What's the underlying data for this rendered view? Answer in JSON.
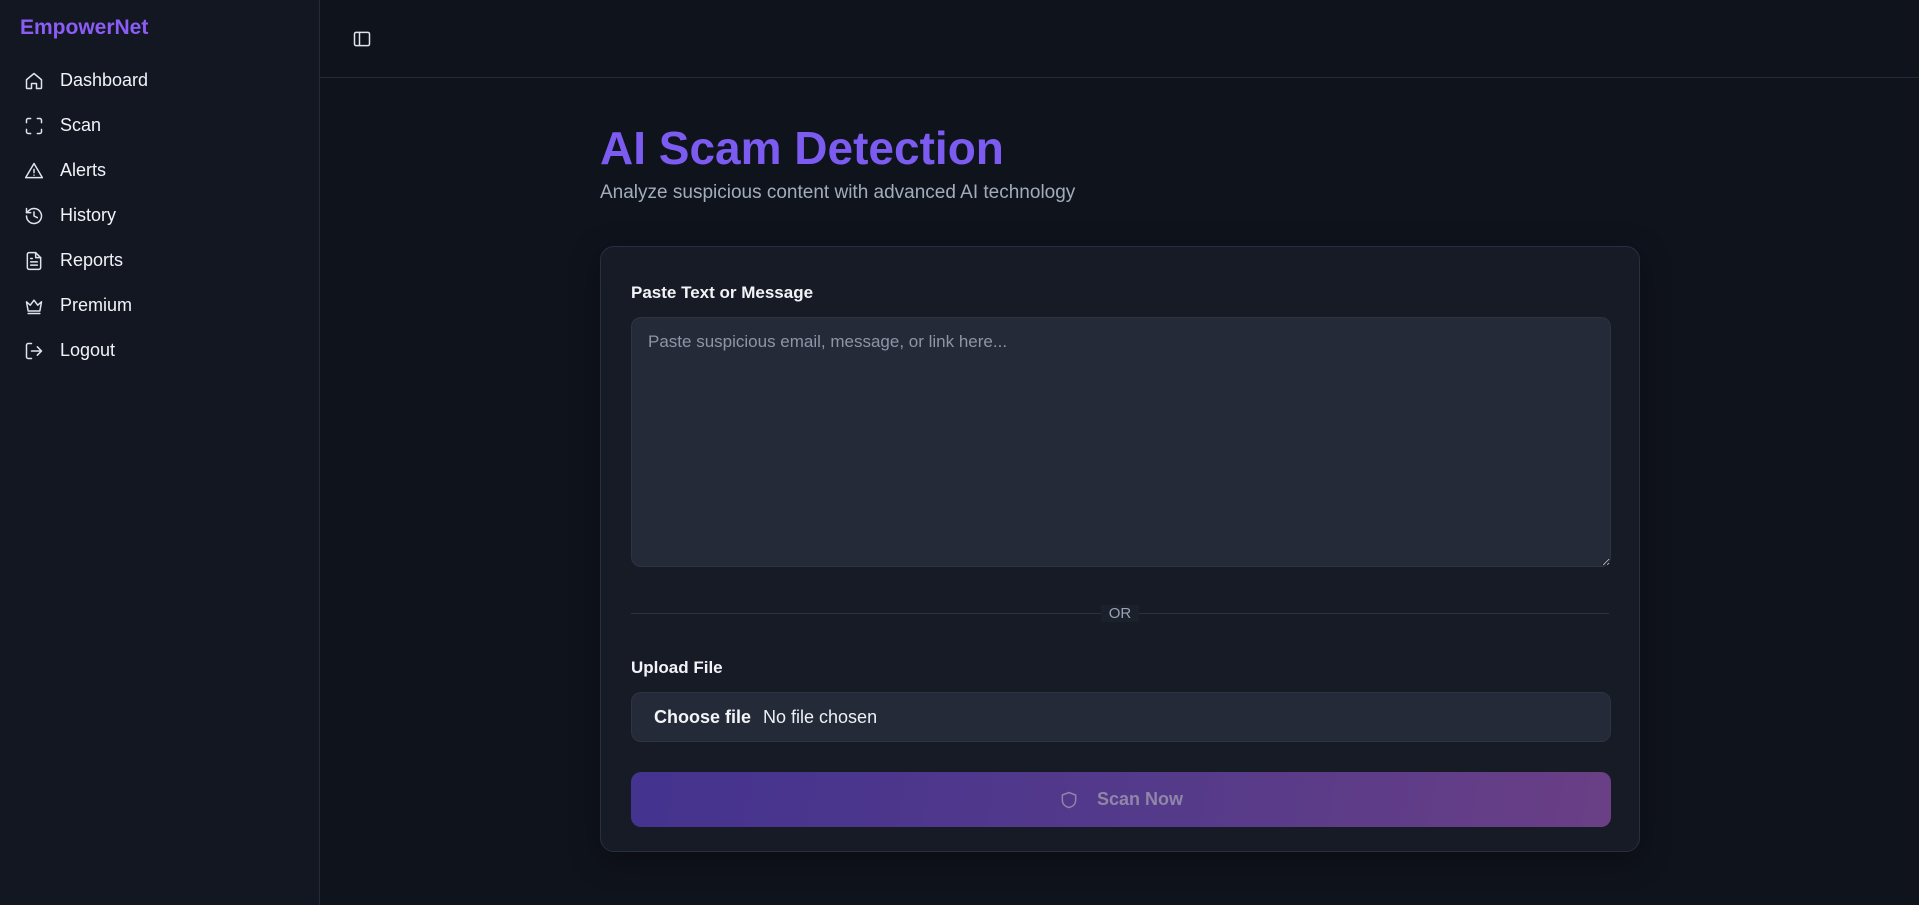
{
  "app": {
    "brand": "EmpowerNet",
    "accent_color": "#7c5cf0"
  },
  "sidebar": {
    "items": [
      {
        "label": "Dashboard",
        "icon": "home-icon"
      },
      {
        "label": "Scan",
        "icon": "scan-icon"
      },
      {
        "label": "Alerts",
        "icon": "alert-triangle-icon"
      },
      {
        "label": "History",
        "icon": "history-icon"
      },
      {
        "label": "Reports",
        "icon": "file-text-icon"
      },
      {
        "label": "Premium",
        "icon": "crown-icon"
      },
      {
        "label": "Logout",
        "icon": "logout-icon"
      }
    ]
  },
  "topbar": {
    "toggle_icon": "sidebar-toggle-icon"
  },
  "page": {
    "title": "AI Scam Detection",
    "subtitle": "Analyze suspicious content with advanced AI technology"
  },
  "form": {
    "text_label": "Paste Text or Message",
    "text_value": "",
    "text_placeholder": "Paste suspicious email, message, or link here...",
    "or_text": "OR",
    "upload_label": "Upload File",
    "choose_file_label": "Choose file",
    "no_file_text": "No file chosen",
    "scan_button_label": "Scan Now",
    "scan_button_icon": "shield-icon"
  }
}
